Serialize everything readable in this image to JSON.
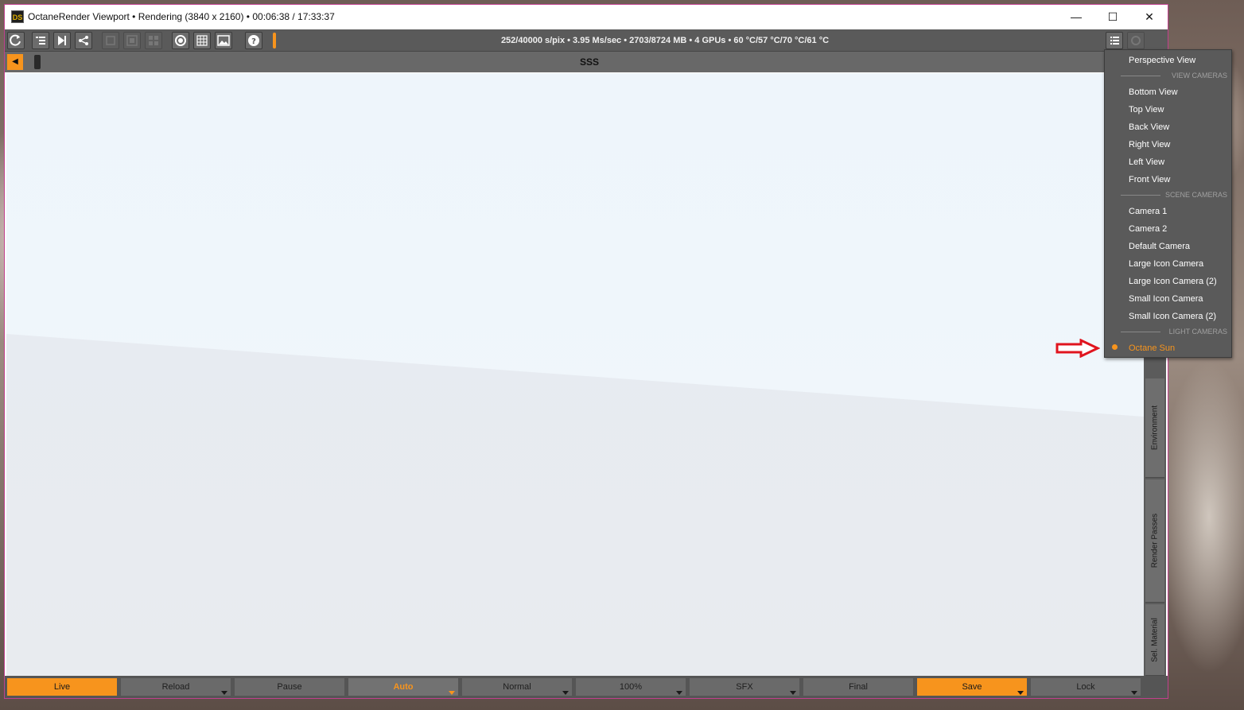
{
  "window": {
    "title": "OctaneRender Viewport • Rendering (3840 x 2160) • 00:06:38 / 17:33:37",
    "icon_text": "DS",
    "minimize_glyph": "—",
    "maximize_glyph": "☐",
    "close_glyph": "✕"
  },
  "toolbar": {
    "stats": "252/40000 s/pix • 3.95 Ms/sec • 2703/8724 MB • 4 GPUs • 60 °C/57 °C/70 °C/61 °C",
    "help_glyph": "?"
  },
  "subbar": {
    "back_glyph": "◀",
    "scene_name": "SSS"
  },
  "side_tabs": [
    "Environment",
    "Render Passes",
    "Sel. Material"
  ],
  "bottom_buttons": [
    "Live",
    "Reload",
    "Pause",
    "Auto",
    "Normal",
    "100%",
    "SFX",
    "Final",
    "Save",
    "Lock"
  ],
  "camera_menu": {
    "perspective": "Perspective View",
    "view_cameras_header": "VIEW CAMERAS",
    "view_cameras": [
      "Bottom View",
      "Top View",
      "Back View",
      "Right View",
      "Left View",
      "Front View"
    ],
    "scene_cameras_header": "SCENE CAMERAS",
    "scene_cameras": [
      "Camera 1",
      "Camera 2",
      "Default Camera",
      "Large Icon Camera",
      "Large Icon Camera (2)",
      "Small Icon Camera",
      "Small Icon Camera (2)"
    ],
    "light_cameras_header": "LIGHT CAMERAS",
    "light_cameras": [
      "Octane Sun"
    ],
    "selected": "Octane Sun"
  },
  "colors": {
    "accent": "#f7941d",
    "annotation_arrow": "#e0141e"
  }
}
